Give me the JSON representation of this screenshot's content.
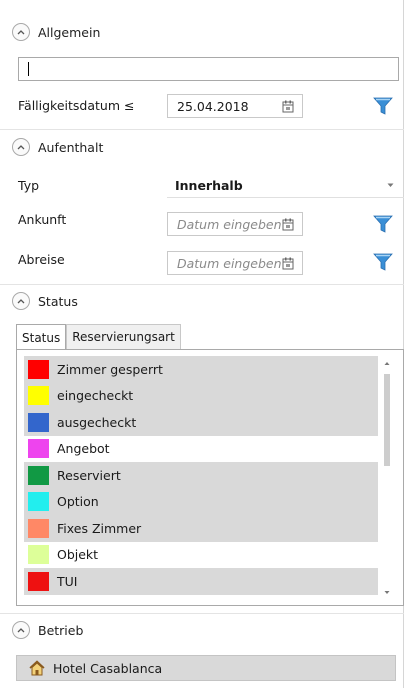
{
  "sections": {
    "allgemein": "Allgemein",
    "aufenthalt": "Aufenthalt",
    "status": "Status",
    "betrieb": "Betrieb"
  },
  "allgemein": {
    "search_value": "",
    "due_label": "Fälligkeitsdatum ≤",
    "due_value": "25.04.2018"
  },
  "aufenthalt": {
    "typ_label": "Typ",
    "typ_value": "Innerhalb",
    "ankunft_label": "Ankunft",
    "ankunft_placeholder": "Datum eingeben",
    "abreise_label": "Abreise",
    "abreise_placeholder": "Datum eingeben"
  },
  "status": {
    "tabs": [
      "Status",
      "Reservierungsart"
    ],
    "active_tab": "Status",
    "items": [
      {
        "label": "Zimmer gesperrt",
        "color": "#ff0000",
        "selected": true
      },
      {
        "label": "eingecheckt",
        "color": "#ffff00",
        "selected": true
      },
      {
        "label": "ausgecheckt",
        "color": "#3366cc",
        "selected": true
      },
      {
        "label": "Angebot",
        "color": "#ee44ee",
        "selected": false
      },
      {
        "label": "Reserviert",
        "color": "#119944",
        "selected": true
      },
      {
        "label": "Option",
        "color": "#22eeee",
        "selected": true
      },
      {
        "label": "Fixes Zimmer",
        "color": "#ff8866",
        "selected": true
      },
      {
        "label": "Objekt",
        "color": "#ddff99",
        "selected": false
      },
      {
        "label": "TUI",
        "color": "#ee1111",
        "selected": true
      }
    ]
  },
  "betrieb": {
    "hotel": "Hotel Casablanca",
    "icon": "home-icon"
  },
  "icons": {
    "collapse": "chevron-up-icon",
    "calendar": "calendar-icon",
    "filter": "funnel-filter-icon",
    "dropdown": "chevron-down-icon"
  },
  "colors": {
    "selected_row": "#d9d9d9",
    "filter_icon": "#3a8fd6"
  }
}
